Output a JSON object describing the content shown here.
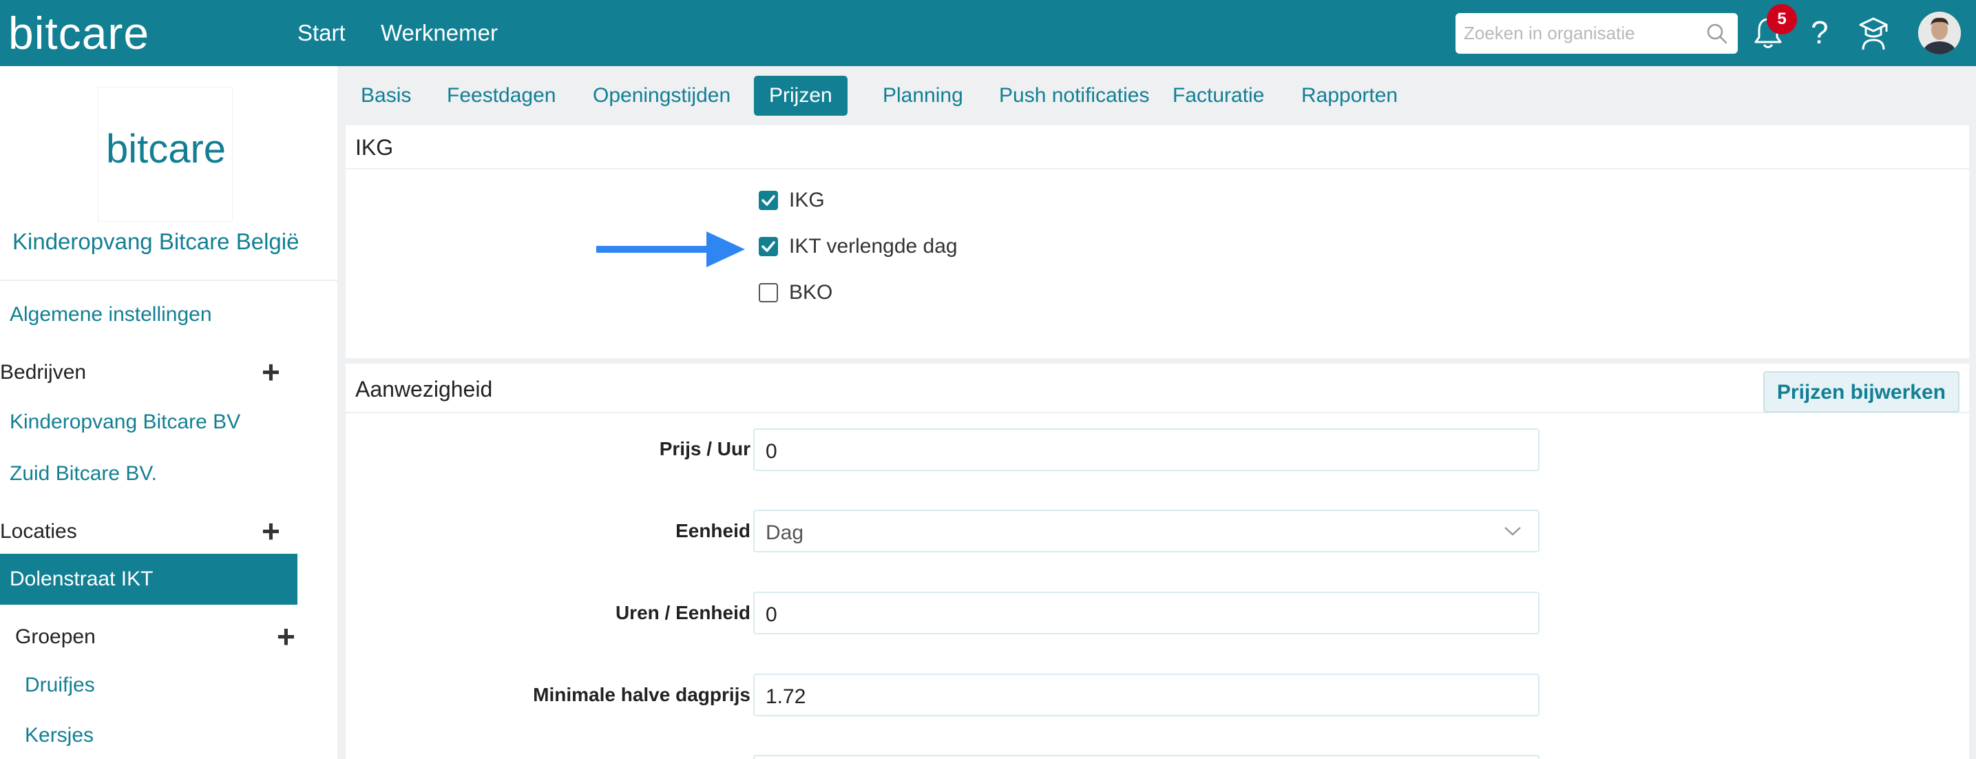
{
  "header": {
    "logo_text": "bitcare",
    "nav": [
      "Start",
      "Werknemer"
    ],
    "search_placeholder": "Zoeken in organisatie",
    "notification_count": "5",
    "help_label": "?"
  },
  "sidebar": {
    "org_logo_text": "bitcare",
    "org_name": "Kinderopvang Bitcare België",
    "general_settings": "Algemene instellingen",
    "companies_heading": "Bedrijven",
    "companies": [
      "Kinderopvang Bitcare BV",
      "Zuid Bitcare BV."
    ],
    "locations_heading": "Locaties",
    "active_location": "Dolenstraat IKT",
    "groups_heading": "Groepen",
    "groups": [
      "Druifjes",
      "Kersjes"
    ]
  },
  "tabs": [
    "Basis",
    "Feestdagen",
    "Openingstijden",
    "Prijzen",
    "Planning",
    "Push notificaties",
    "Facturatie",
    "Rapporten"
  ],
  "active_tab": "Prijzen",
  "ikg_panel": {
    "title": "IKG",
    "checkboxes": [
      {
        "label": "IKG",
        "checked": true
      },
      {
        "label": "IKT verlengde dag",
        "checked": true
      },
      {
        "label": "BKO",
        "checked": false
      }
    ]
  },
  "attendance_panel": {
    "title": "Aanwezigheid",
    "update_button": "Prijzen bijwerken",
    "fields": [
      {
        "label": "Prijs / Uur",
        "value": "0"
      },
      {
        "label": "Eenheid",
        "value": "Dag"
      },
      {
        "label": "Uren / Eenheid",
        "value": "0"
      },
      {
        "label": "Minimale halve dagprijs",
        "value": "1.72"
      }
    ]
  },
  "colors": {
    "brand": "#127f93",
    "arrow": "#2f86f2",
    "badge": "#d0021b"
  }
}
